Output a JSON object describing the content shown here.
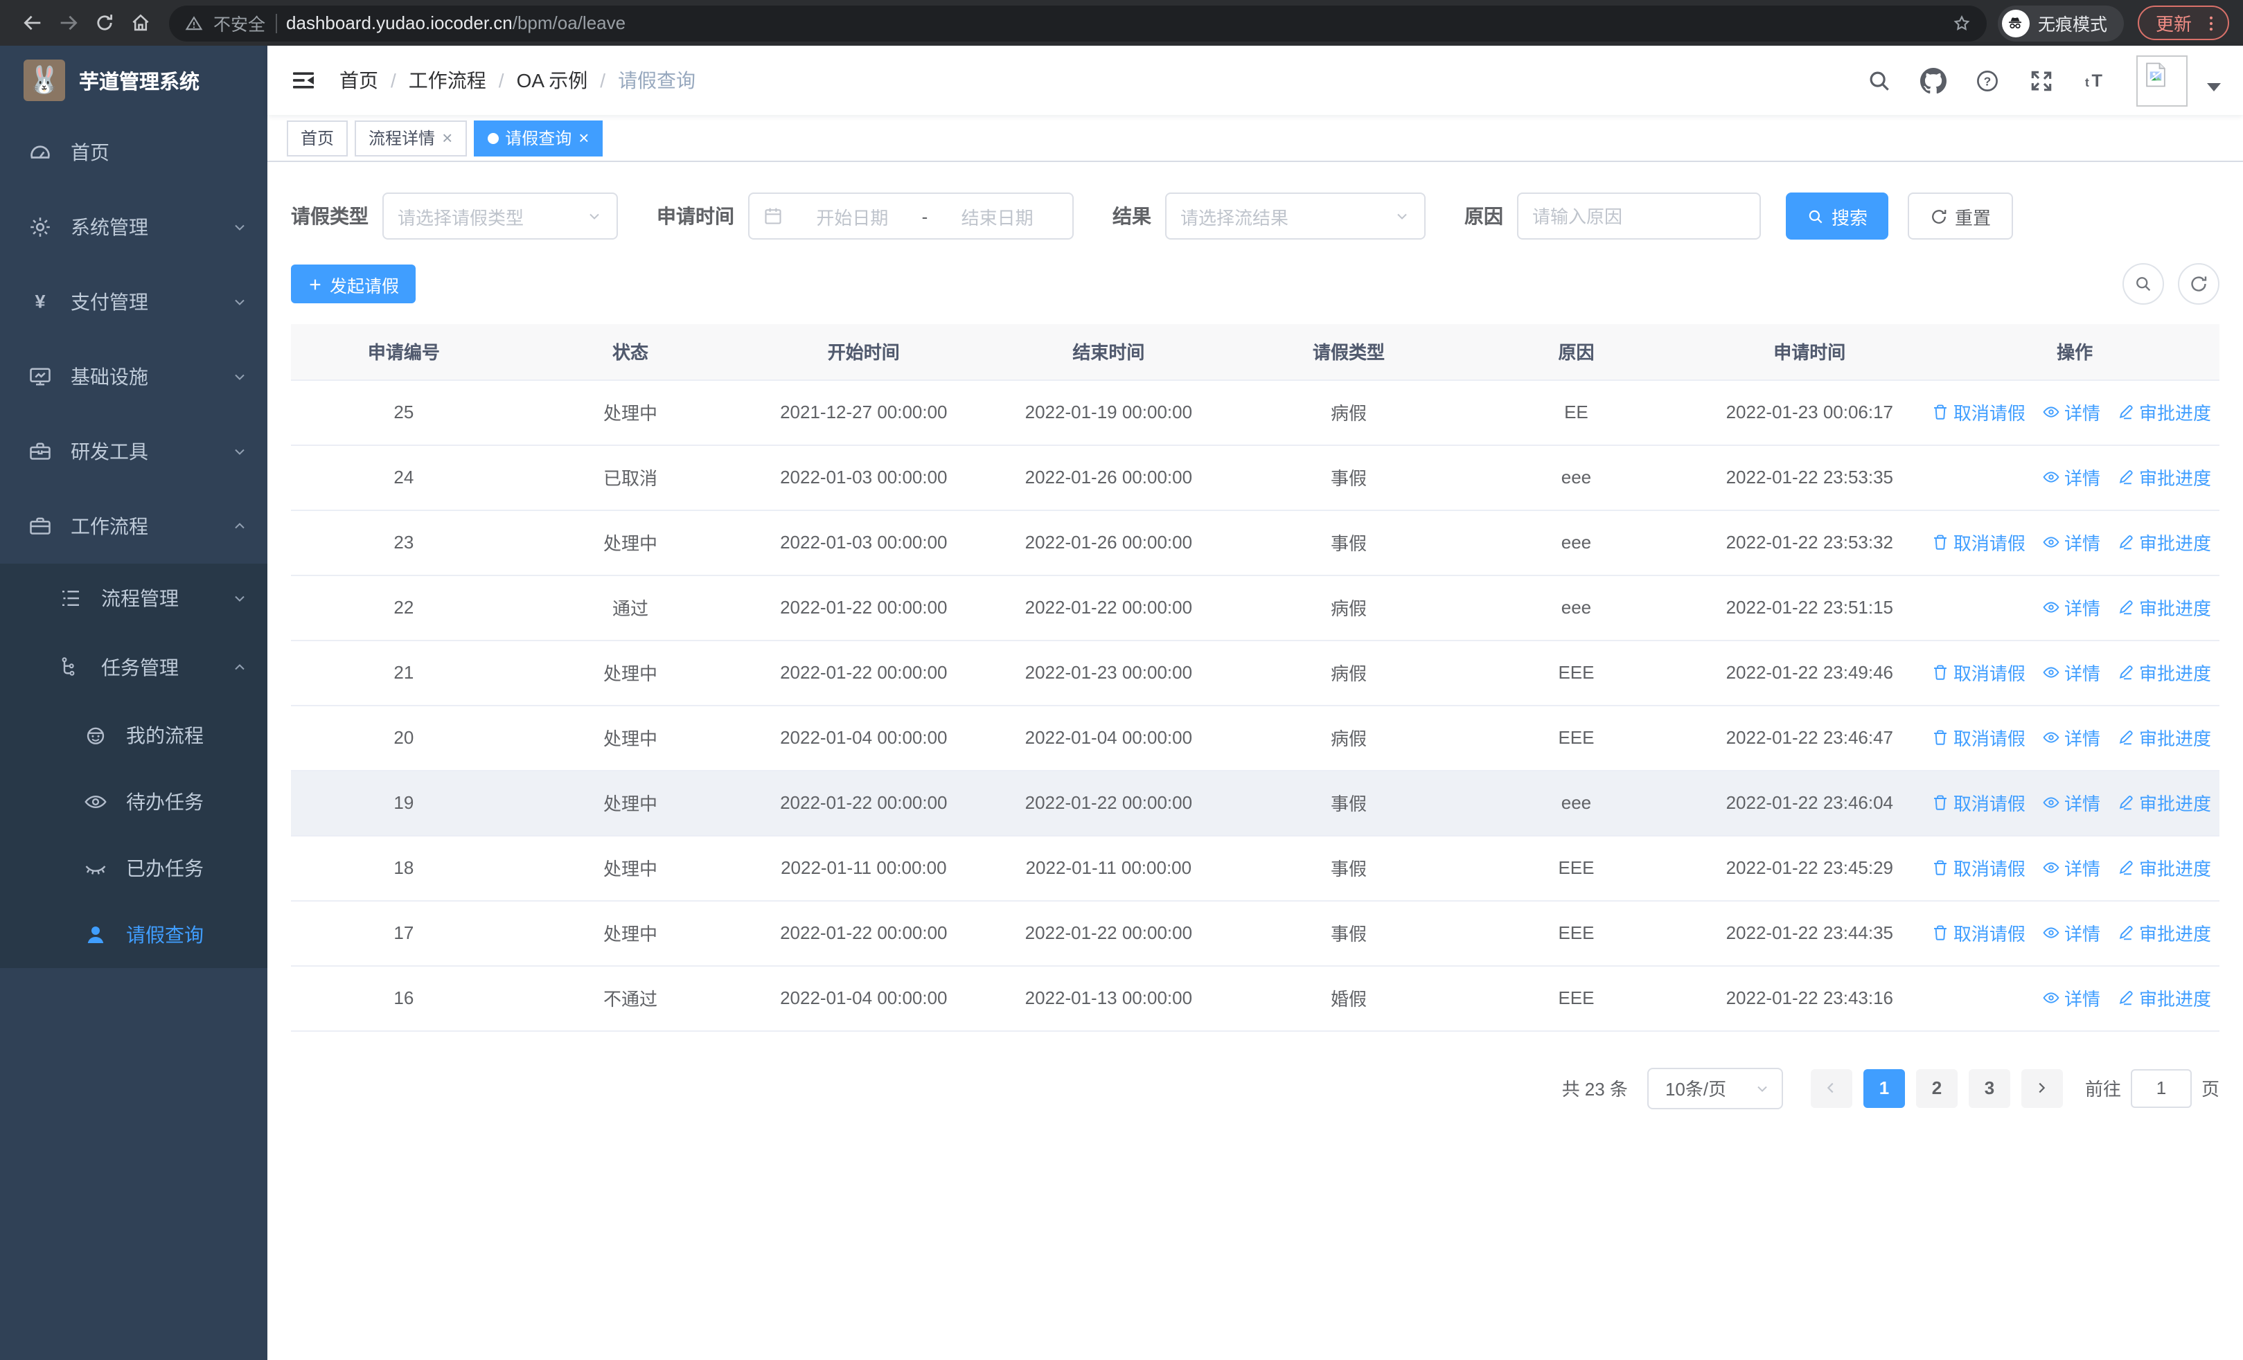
{
  "browser": {
    "security_label": "不安全",
    "url_host": "dashboard.yudao.iocoder.cn",
    "url_path": "/bpm/oa/leave",
    "incognito_label": "无痕模式",
    "update_label": "更新"
  },
  "sidebar": {
    "title": "芋道管理系统",
    "items": [
      {
        "label": "首页",
        "icon": "dashboard-icon"
      },
      {
        "label": "系统管理",
        "icon": "gear-icon"
      },
      {
        "label": "支付管理",
        "icon": "yen-icon"
      },
      {
        "label": "基础设施",
        "icon": "monitor-icon"
      },
      {
        "label": "研发工具",
        "icon": "toolbox-icon"
      },
      {
        "label": "工作流程",
        "icon": "briefcase-icon",
        "children": [
          {
            "label": "流程管理",
            "icon": "list-icon"
          },
          {
            "label": "任务管理",
            "icon": "tree-icon",
            "children": [
              {
                "label": "我的流程",
                "icon": "robot-face-icon"
              },
              {
                "label": "待办任务",
                "icon": "eye-icon"
              },
              {
                "label": "已办任务",
                "icon": "eye-closed-icon"
              },
              {
                "label": "请假查询",
                "icon": "user-icon",
                "active": true
              }
            ]
          }
        ]
      }
    ]
  },
  "header": {
    "breadcrumb": [
      "首页",
      "工作流程",
      "OA 示例",
      "请假查询"
    ]
  },
  "tabs": {
    "items": [
      {
        "label": "首页",
        "closable": false,
        "active": false
      },
      {
        "label": "流程详情",
        "closable": true,
        "active": false
      },
      {
        "label": "请假查询",
        "closable": true,
        "active": true
      }
    ]
  },
  "filters": {
    "leave_type_label": "请假类型",
    "leave_type_placeholder": "请选择请假类型",
    "apply_time_label": "申请时间",
    "date_start_placeholder": "开始日期",
    "date_separator": "-",
    "date_end_placeholder": "结束日期",
    "result_label": "结果",
    "result_placeholder": "请选择流结果",
    "reason_label": "原因",
    "reason_placeholder": "请输入原因",
    "search_button": "搜索",
    "reset_button": "重置"
  },
  "toolbar": {
    "create_button": "发起请假"
  },
  "table": {
    "columns": [
      "申请编号",
      "状态",
      "开始时间",
      "结束时间",
      "请假类型",
      "原因",
      "申请时间",
      "操作"
    ],
    "action_defs": {
      "cancel": {
        "label": "取消请假",
        "icon": "ic-trash"
      },
      "detail": {
        "label": "详情",
        "icon": "ic-view"
      },
      "progress": {
        "label": "审批进度",
        "icon": "ic-edit"
      }
    },
    "rows": [
      {
        "id": "25",
        "status": "处理中",
        "start": "2021-12-27 00:00:00",
        "end": "2022-01-19 00:00:00",
        "type": "病假",
        "reason": "EE",
        "apply_time": "2022-01-23 00:06:17",
        "actions": [
          "cancel",
          "detail",
          "progress"
        ]
      },
      {
        "id": "24",
        "status": "已取消",
        "start": "2022-01-03 00:00:00",
        "end": "2022-01-26 00:00:00",
        "type": "事假",
        "reason": "eee",
        "apply_time": "2022-01-22 23:53:35",
        "actions": [
          "detail",
          "progress"
        ]
      },
      {
        "id": "23",
        "status": "处理中",
        "start": "2022-01-03 00:00:00",
        "end": "2022-01-26 00:00:00",
        "type": "事假",
        "reason": "eee",
        "apply_time": "2022-01-22 23:53:32",
        "actions": [
          "cancel",
          "detail",
          "progress"
        ]
      },
      {
        "id": "22",
        "status": "通过",
        "start": "2022-01-22 00:00:00",
        "end": "2022-01-22 00:00:00",
        "type": "病假",
        "reason": "eee",
        "apply_time": "2022-01-22 23:51:15",
        "actions": [
          "detail",
          "progress"
        ]
      },
      {
        "id": "21",
        "status": "处理中",
        "start": "2022-01-22 00:00:00",
        "end": "2022-01-23 00:00:00",
        "type": "病假",
        "reason": "EEE",
        "apply_time": "2022-01-22 23:49:46",
        "actions": [
          "cancel",
          "detail",
          "progress"
        ]
      },
      {
        "id": "20",
        "status": "处理中",
        "start": "2022-01-04 00:00:00",
        "end": "2022-01-04 00:00:00",
        "type": "病假",
        "reason": "EEE",
        "apply_time": "2022-01-22 23:46:47",
        "actions": [
          "cancel",
          "detail",
          "progress"
        ]
      },
      {
        "id": "19",
        "status": "处理中",
        "start": "2022-01-22 00:00:00",
        "end": "2022-01-22 00:00:00",
        "type": "事假",
        "reason": "eee",
        "apply_time": "2022-01-22 23:46:04",
        "actions": [
          "cancel",
          "detail",
          "progress"
        ],
        "highlight": true
      },
      {
        "id": "18",
        "status": "处理中",
        "start": "2022-01-11 00:00:00",
        "end": "2022-01-11 00:00:00",
        "type": "事假",
        "reason": "EEE",
        "apply_time": "2022-01-22 23:45:29",
        "actions": [
          "cancel",
          "detail",
          "progress"
        ]
      },
      {
        "id": "17",
        "status": "处理中",
        "start": "2022-01-22 00:00:00",
        "end": "2022-01-22 00:00:00",
        "type": "事假",
        "reason": "EEE",
        "apply_time": "2022-01-22 23:44:35",
        "actions": [
          "cancel",
          "detail",
          "progress"
        ]
      },
      {
        "id": "16",
        "status": "不通过",
        "start": "2022-01-04 00:00:00",
        "end": "2022-01-13 00:00:00",
        "type": "婚假",
        "reason": "EEE",
        "apply_time": "2022-01-22 23:43:16",
        "actions": [
          "detail",
          "progress"
        ]
      }
    ]
  },
  "pagination": {
    "total_text": "共 23 条",
    "page_size": "10条/页",
    "pages": [
      "1",
      "2",
      "3"
    ],
    "active_page": "1",
    "goto_label": "前往",
    "goto_value": "1",
    "goto_suffix": "页"
  },
  "icons": [
    "back-icon",
    "forward-icon",
    "reload-icon",
    "home-icon",
    "warning-icon",
    "bookmark-star-icon",
    "incognito-icon",
    "kebab-menu-icon",
    "collapse-sidebar-icon",
    "search-icon",
    "github-icon",
    "question-icon",
    "fullscreen-icon",
    "font-size-icon",
    "broken-image-avatar",
    "calendar-icon",
    "refresh-icon",
    "plus-icon",
    "trash-icon",
    "view-eye-icon",
    "edit-pen-icon"
  ],
  "colors": {
    "primary": "#409eff",
    "sidebar_bg": "#304156",
    "sidebar_submenu_bg": "#283848",
    "sidebar_text": "#bfcbd9",
    "table_header_bg": "#f8f8f9",
    "row_border": "#ebeef5",
    "chrome_bg": "#2c2e31",
    "update_accent": "#f08d85"
  }
}
